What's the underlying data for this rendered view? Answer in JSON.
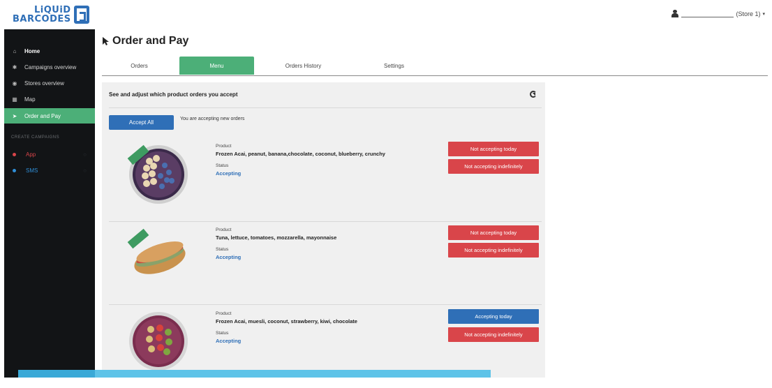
{
  "brand": {
    "line1": "LiQUiD",
    "line2": "BARCODES",
    "color": "#2f6fb7"
  },
  "user": {
    "store_label": "(Store 1)"
  },
  "sidebar": {
    "items": [
      {
        "label": "Home",
        "icon": "home-icon"
      },
      {
        "label": "Campaigns overview",
        "icon": "star-icon"
      },
      {
        "label": "Stores overview",
        "icon": "pin-icon"
      },
      {
        "label": "Map",
        "icon": "map-icon"
      },
      {
        "label": "Order and Pay",
        "icon": "cursor-icon"
      }
    ],
    "section_title": "CREATE CAMPAIGNS",
    "campaigns": [
      {
        "label": "App",
        "color": "#d9454a"
      },
      {
        "label": "SMS",
        "color": "#2f8fd8"
      }
    ]
  },
  "page": {
    "title": "Order and Pay"
  },
  "tabs": [
    {
      "label": "Orders"
    },
    {
      "label": "Menu"
    },
    {
      "label": "Orders History"
    },
    {
      "label": "Settings"
    }
  ],
  "panel": {
    "header": "See and adjust which product orders you accept",
    "accept_all_label": "Accept All",
    "accept_status": "You are accepting new orders"
  },
  "products": [
    {
      "product_label": "Product",
      "name": "Frozen Acai, peanut, banana,chocolate, coconut, blueberry, crunchy",
      "status_label": "Status",
      "status": "Accepting",
      "btn_today": "Not accepting today",
      "btn_indef": "Not accepting indefinitely"
    },
    {
      "product_label": "Product",
      "name": "Tuna, lettuce, tomatoes, mozzarella, mayonnaise",
      "status_label": "Status",
      "status": "Accepting",
      "btn_today": "Not accepting today",
      "btn_indef": "Not accepting indefinitely"
    },
    {
      "product_label": "Product",
      "name": "Frozen Acai, muesli, coconut, strawberry, kiwi, chocolate",
      "status_label": "Status",
      "status": "Accepting",
      "btn_today": "Accepting today",
      "btn_indef": "Not accepting indefinitely"
    }
  ]
}
